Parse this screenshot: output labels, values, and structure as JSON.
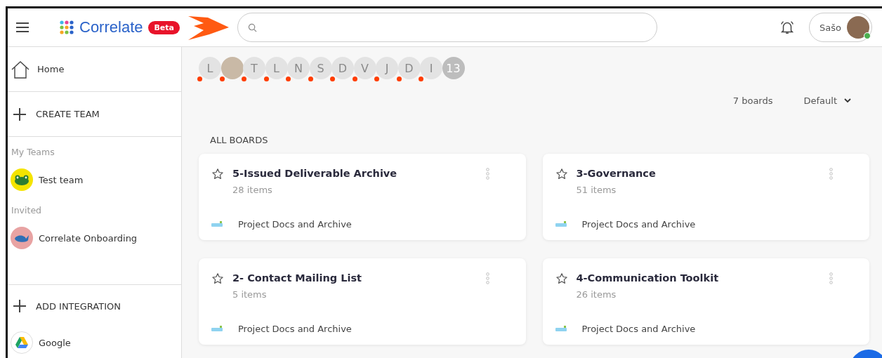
{
  "header": {
    "app_name": "Correlate",
    "badge": "Beta",
    "user": {
      "name": "Sašo",
      "online": true
    }
  },
  "sidebar": {
    "home": "Home",
    "create_team": "CREATE TEAM",
    "sections": [
      {
        "title": "My Teams",
        "teams": [
          {
            "name": "Test team",
            "kind": "frog",
            "color": "#f5e400"
          }
        ]
      },
      {
        "title": "Invited",
        "teams": [
          {
            "name": "Correlate Onboarding",
            "kind": "whale",
            "color": "#e8a3a3"
          }
        ]
      }
    ],
    "add_integration": "ADD INTEGRATION",
    "integrations": [
      {
        "name": "Google"
      }
    ]
  },
  "members": [
    {
      "kind": "letter",
      "label": "L"
    },
    {
      "kind": "photo"
    },
    {
      "kind": "letter",
      "label": "T"
    },
    {
      "kind": "letter",
      "label": "L"
    },
    {
      "kind": "letter",
      "label": "N"
    },
    {
      "kind": "letter",
      "label": "S"
    },
    {
      "kind": "letter",
      "label": "D"
    },
    {
      "kind": "letter",
      "label": "V"
    },
    {
      "kind": "letter",
      "label": "J"
    },
    {
      "kind": "letter",
      "label": "D"
    },
    {
      "kind": "letter",
      "label": "I"
    },
    {
      "kind": "more",
      "label": "13"
    }
  ],
  "board_count": "7 boards",
  "sort": "Default",
  "section_title": "ALL BOARDS",
  "boards": [
    {
      "title": "5-Issued Deliverable Archive",
      "count": "28 items",
      "team": "Project Docs and Archive",
      "starred": false
    },
    {
      "title": "3-Governance",
      "count": "51 items",
      "team": "Project Docs and Archive",
      "starred": false
    },
    {
      "title": "2- Contact Mailing List",
      "count": "5 items",
      "team": "Project Docs and Archive",
      "starred": false
    },
    {
      "title": "4-Communication Toolkit",
      "count": "26 items",
      "team": "Project Docs and Archive",
      "starred": false
    }
  ]
}
